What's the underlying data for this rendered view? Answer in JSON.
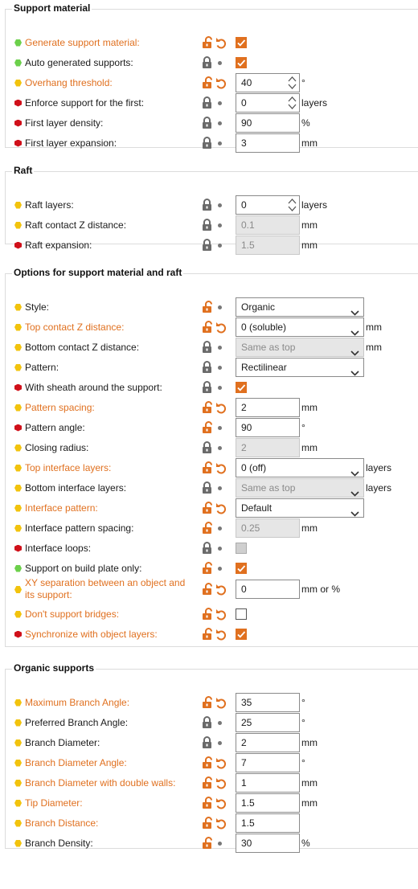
{
  "colors": {
    "modified": "#e0701f",
    "green": "#6cd04b",
    "yellow": "#f2c30d",
    "red": "#d0101a"
  },
  "groups": [
    {
      "title": "Support material",
      "rows": [
        {
          "label": "Generate support material:",
          "dot": "green",
          "mod": true,
          "lock": "open",
          "undo": true,
          "ctrl": "checkbox",
          "checked": true
        },
        {
          "label": "Auto generated supports:",
          "dot": "green",
          "mod": false,
          "lock": "closed",
          "undo": false,
          "ctrl": "checkbox",
          "checked": true
        },
        {
          "label": "Overhang threshold:",
          "dot": "yellow",
          "mod": true,
          "lock": "open",
          "undo": true,
          "ctrl": "spin",
          "value": "40",
          "unit": "°"
        },
        {
          "label": "Enforce support for the first:",
          "dot": "red",
          "mod": false,
          "lock": "closed",
          "undo": false,
          "ctrl": "spin",
          "value": "0",
          "unit": "layers"
        },
        {
          "label": "First layer density:",
          "dot": "red",
          "mod": false,
          "lock": "closed",
          "undo": false,
          "ctrl": "text",
          "value": "90",
          "unit": "%"
        },
        {
          "label": "First layer expansion:",
          "dot": "red",
          "mod": false,
          "lock": "closed",
          "undo": false,
          "ctrl": "text",
          "value": "3",
          "unit": "mm"
        }
      ]
    },
    {
      "title": "Raft",
      "rows": [
        {
          "label": "Raft layers:",
          "dot": "yellow",
          "mod": false,
          "lock": "closed",
          "undo": false,
          "ctrl": "spin",
          "value": "0",
          "unit": "layers"
        },
        {
          "label": "Raft contact Z distance:",
          "dot": "yellow",
          "mod": false,
          "lock": "closed",
          "undo": false,
          "ctrl": "text",
          "value": "0.1",
          "unit": "mm",
          "disabled": true
        },
        {
          "label": "Raft expansion:",
          "dot": "red",
          "mod": false,
          "lock": "closed",
          "undo": false,
          "ctrl": "text",
          "value": "1.5",
          "unit": "mm",
          "disabled": true
        }
      ]
    },
    {
      "title": "Options for support material and raft",
      "rows": [
        {
          "label": "Style:",
          "dot": "yellow",
          "mod": false,
          "lock": "open",
          "undo": false,
          "ctrl": "select",
          "value": "Organic"
        },
        {
          "label": "Top contact Z distance:",
          "dot": "yellow",
          "mod": true,
          "lock": "open",
          "undo": true,
          "ctrl": "select",
          "value": "0 (soluble)",
          "unit": "mm"
        },
        {
          "label": "Bottom contact Z distance:",
          "dot": "yellow",
          "mod": false,
          "lock": "closed",
          "undo": false,
          "ctrl": "select",
          "value": "Same as top",
          "unit": "mm",
          "disabled": true
        },
        {
          "label": "Pattern:",
          "dot": "yellow",
          "mod": false,
          "lock": "closed",
          "undo": false,
          "ctrl": "select",
          "value": "Rectilinear"
        },
        {
          "label": "With sheath around the support:",
          "dot": "red",
          "mod": false,
          "lock": "closed",
          "undo": false,
          "ctrl": "checkbox",
          "checked": true
        },
        {
          "label": "Pattern spacing:",
          "dot": "yellow",
          "mod": true,
          "lock": "open",
          "undo": true,
          "ctrl": "text",
          "value": "2",
          "unit": "mm"
        },
        {
          "label": "Pattern angle:",
          "dot": "red",
          "mod": false,
          "lock": "open",
          "undo": false,
          "ctrl": "text",
          "value": "90",
          "unit": "°"
        },
        {
          "label": "Closing radius:",
          "dot": "yellow",
          "mod": false,
          "lock": "closed",
          "undo": false,
          "ctrl": "text",
          "value": "2",
          "unit": "mm",
          "disabled": true
        },
        {
          "label": "Top interface layers:",
          "dot": "yellow",
          "mod": true,
          "lock": "open",
          "undo": true,
          "ctrl": "select",
          "value": "0 (off)",
          "unit": "layers"
        },
        {
          "label": "Bottom interface layers:",
          "dot": "yellow",
          "mod": false,
          "lock": "closed",
          "undo": false,
          "ctrl": "select",
          "value": "Same as top",
          "unit": "layers",
          "disabled": true
        },
        {
          "label": "Interface pattern:",
          "dot": "yellow",
          "mod": true,
          "lock": "open",
          "undo": true,
          "ctrl": "select",
          "value": "Default"
        },
        {
          "label": "Interface pattern spacing:",
          "dot": "yellow",
          "mod": false,
          "lock": "open",
          "undo": false,
          "ctrl": "text",
          "value": "0.25",
          "unit": "mm",
          "disabled": true
        },
        {
          "label": "Interface loops:",
          "dot": "red",
          "mod": false,
          "lock": "closed",
          "undo": false,
          "ctrl": "checkbox",
          "checked": false,
          "disabled": true
        },
        {
          "label": "Support on build plate only:",
          "dot": "green",
          "mod": false,
          "lock": "open",
          "undo": false,
          "ctrl": "checkbox",
          "checked": true
        },
        {
          "label": "XY separation between an object and its support:",
          "dot": "yellow",
          "mod": true,
          "lock": "open",
          "undo": true,
          "ctrl": "text",
          "value": "0",
          "unit": "mm or %",
          "two": true
        },
        {
          "label": "Don't support bridges:",
          "dot": "yellow",
          "mod": true,
          "lock": "open",
          "undo": true,
          "ctrl": "checkbox",
          "checked": false
        },
        {
          "label": "Synchronize with object layers:",
          "dot": "red",
          "mod": true,
          "lock": "open",
          "undo": true,
          "ctrl": "checkbox",
          "checked": true
        }
      ]
    },
    {
      "title": "Organic supports",
      "rows": [
        {
          "label": "Maximum Branch Angle:",
          "dot": "yellow",
          "mod": true,
          "lock": "open",
          "undo": true,
          "ctrl": "text",
          "value": "35",
          "unit": "°"
        },
        {
          "label": "Preferred Branch Angle:",
          "dot": "yellow",
          "mod": false,
          "lock": "closed",
          "undo": false,
          "ctrl": "text",
          "value": "25",
          "unit": "°"
        },
        {
          "label": "Branch Diameter:",
          "dot": "yellow",
          "mod": false,
          "lock": "closed",
          "undo": false,
          "ctrl": "text",
          "value": "2",
          "unit": "mm"
        },
        {
          "label": "Branch Diameter Angle:",
          "dot": "yellow",
          "mod": true,
          "lock": "open",
          "undo": true,
          "ctrl": "text",
          "value": "7",
          "unit": "°"
        },
        {
          "label": "Branch Diameter with double walls:",
          "dot": "yellow",
          "mod": true,
          "lock": "open",
          "undo": true,
          "ctrl": "text",
          "value": "1",
          "unit": "mm"
        },
        {
          "label": "Tip Diameter:",
          "dot": "yellow",
          "mod": true,
          "lock": "open",
          "undo": true,
          "ctrl": "text",
          "value": "1.5",
          "unit": "mm"
        },
        {
          "label": "Branch Distance:",
          "dot": "yellow",
          "mod": true,
          "lock": "open",
          "undo": true,
          "ctrl": "text",
          "value": "1.5",
          "unit": ""
        },
        {
          "label": "Branch Density:",
          "dot": "yellow",
          "mod": false,
          "lock": "open",
          "undo": false,
          "ctrl": "text",
          "value": "30",
          "unit": "%"
        }
      ]
    }
  ]
}
